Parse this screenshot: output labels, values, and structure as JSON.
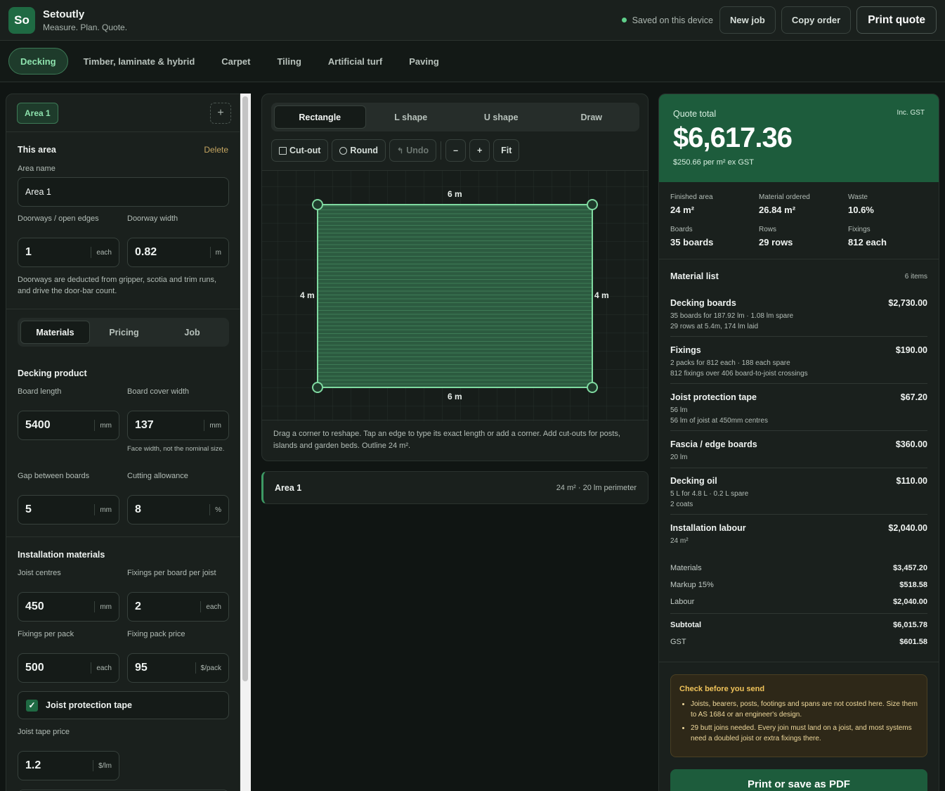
{
  "header": {
    "logo": "So",
    "title": "Setoutly",
    "subtitle": "Measure. Plan. Quote.",
    "saved": "Saved on this device",
    "new_job": "New job",
    "copy_order": "Copy order",
    "print_quote": "Print quote"
  },
  "tabs": [
    "Decking",
    "Timber, laminate & hybrid",
    "Carpet",
    "Tiling",
    "Artificial turf",
    "Paving"
  ],
  "left": {
    "area_chip": "Area 1",
    "add": "+",
    "this_area": "This area",
    "delete": "Delete",
    "area_name_label": "Area name",
    "area_name": "Area 1",
    "doorways_label": "Doorways / open edges",
    "doorways": "1",
    "doorways_unit": "each",
    "doorway_width_label": "Doorway width",
    "doorway_width": "0.82",
    "doorway_width_unit": "m",
    "doorway_note": "Doorways are deducted from gripper, scotia and trim runs, and drive the door-bar count.",
    "subtabs": [
      "Materials",
      "Pricing",
      "Job"
    ],
    "product_heading": "Decking product",
    "board_length_label": "Board length",
    "board_length": "5400",
    "board_length_unit": "mm",
    "cover_width_label": "Board cover width",
    "cover_width": "137",
    "cover_width_unit": "mm",
    "cover_note": "Face width, not the nominal size.",
    "gap_label": "Gap between boards",
    "gap": "5",
    "gap_unit": "mm",
    "cutting_label": "Cutting allowance",
    "cutting": "8",
    "cutting_unit": "%",
    "install_heading": "Installation materials",
    "joist_label": "Joist centres",
    "joist": "450",
    "joist_unit": "mm",
    "fixings_per_label": "Fixings per board per joist",
    "fixings_per": "2",
    "fixings_per_unit": "each",
    "fixings_pack_label": "Fixings per pack",
    "fixings_pack": "500",
    "fixings_pack_unit": "each",
    "pack_price_label": "Fixing pack price",
    "pack_price": "95",
    "pack_price_unit": "$/pack",
    "tape_check": "Joist protection tape",
    "tape_price_label": "Joist tape price",
    "tape_price": "1.2",
    "tape_price_unit": "$/lm"
  },
  "canvas": {
    "shapes": [
      "Rectangle",
      "L shape",
      "U shape",
      "Draw"
    ],
    "cutout": "Cut-out",
    "round": "Round",
    "undo": "Undo",
    "minus": "–",
    "plus": "+",
    "fit": "Fit",
    "dim_top": "6 m",
    "dim_bottom": "6 m",
    "dim_left": "4 m",
    "dim_right": "4 m",
    "hint": "Drag a corner to reshape. Tap an edge to type its exact length or add a corner. Add cut-outs for posts, islands and garden beds. Outline 24 m².",
    "area_row_name": "Area 1",
    "area_row_meta": "24 m² · 20 lm perimeter"
  },
  "quote": {
    "label": "Quote total",
    "gst": "Inc. GST",
    "total": "$6,617.36",
    "per_m2": "$250.66 per m² ex GST",
    "stats": [
      {
        "k": "Finished area",
        "v": "24 m²"
      },
      {
        "k": "Material ordered",
        "v": "26.84 m²"
      },
      {
        "k": "Waste",
        "v": "10.6%"
      },
      {
        "k": "Boards",
        "v": "35 boards"
      },
      {
        "k": "Rows",
        "v": "29 rows"
      },
      {
        "k": "Fixings",
        "v": "812 each"
      }
    ],
    "material_list": "Material list",
    "items_count": "6 items",
    "items": [
      {
        "n": "Decking boards",
        "p": "$2,730.00",
        "d1": "35 boards for 187.92 lm · 1.08 lm spare",
        "d2": "29 rows at 5.4m, 174 lm laid"
      },
      {
        "n": "Fixings",
        "p": "$190.00",
        "d1": "2 packs for 812 each · 188 each spare",
        "d2": "812 fixings over 406 board-to-joist crossings"
      },
      {
        "n": "Joist protection tape",
        "p": "$67.20",
        "d1": "56 lm",
        "d2": "56 lm of joist at 450mm centres"
      },
      {
        "n": "Fascia / edge boards",
        "p": "$360.00",
        "d1": "20 lm",
        "d2": ""
      },
      {
        "n": "Decking oil",
        "p": "$110.00",
        "d1": "5 L for 4.8 L · 0.2 L spare",
        "d2": "2 coats"
      },
      {
        "n": "Installation labour",
        "p": "$2,040.00",
        "d1": "24 m²",
        "d2": ""
      }
    ],
    "materials_label": "Materials",
    "materials": "$3,457.20",
    "markup_label": "Markup 15%",
    "markup": "$518.58",
    "labour_label": "Labour",
    "labour": "$2,040.00",
    "subtotal_label": "Subtotal",
    "subtotal": "$6,015.78",
    "gst_label": "GST",
    "gst_value": "$601.58",
    "warn_heading": "Check before you send",
    "warn1": "Joists, bearers, posts, footings and spans are not costed here. Size them to AS 1684 or an engineer's design.",
    "warn2": "29 butt joins needed. Every join must land on a joist, and most systems need a doubled joist or extra fixings there.",
    "pdf": "Print or save as PDF"
  },
  "colors": {
    "accent": "#1d5c3c",
    "accent_light": "#8de2ad",
    "outline": "#7fd9a0"
  }
}
